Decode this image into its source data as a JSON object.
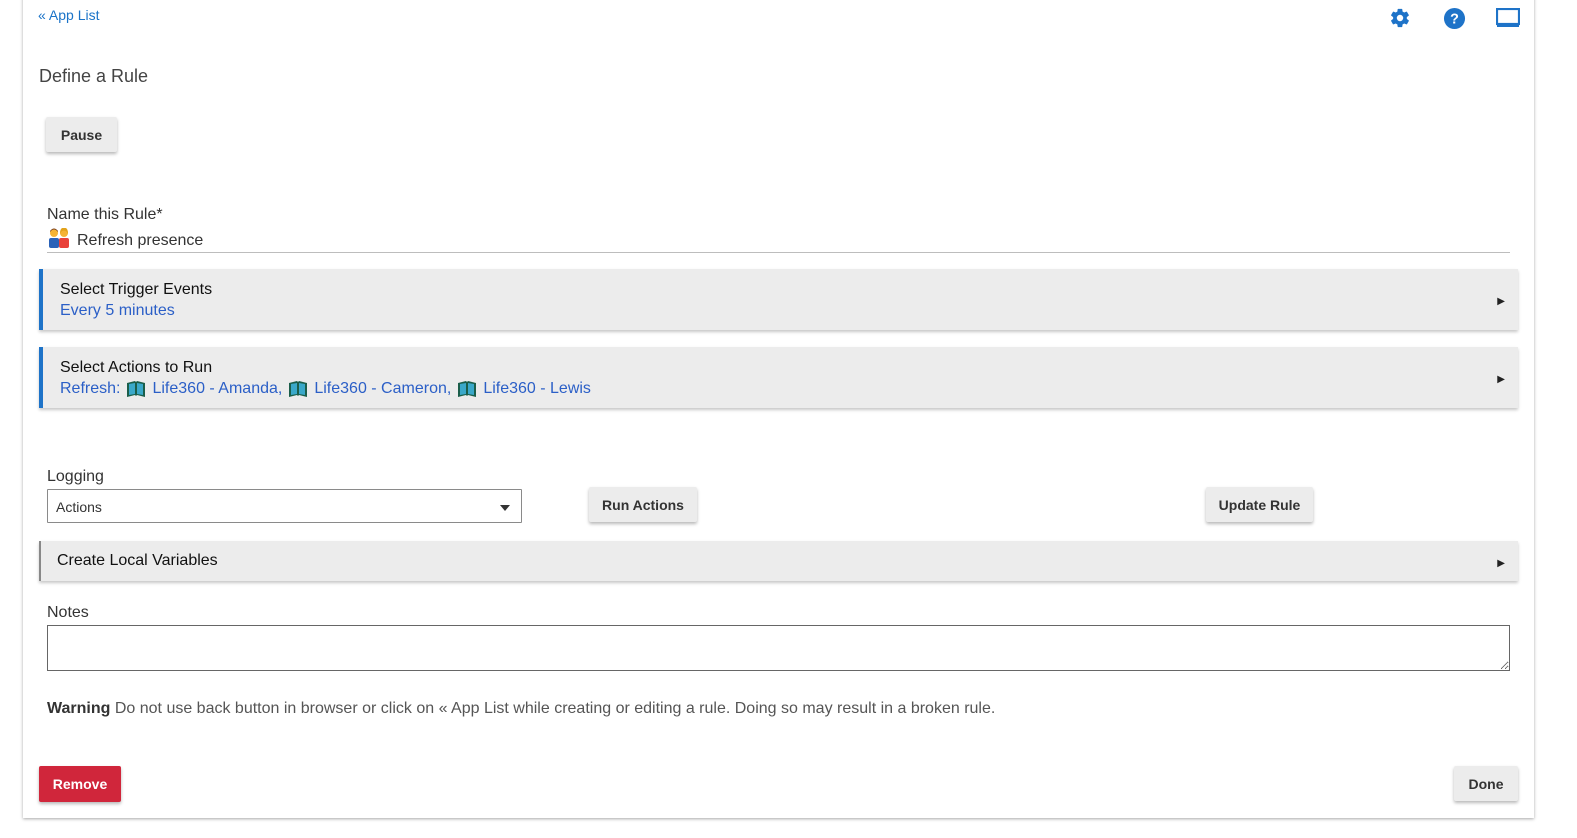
{
  "header": {
    "back_link": "« App List",
    "icons": [
      "gear-icon",
      "help-icon",
      "monitor-icon"
    ]
  },
  "page": {
    "title": "Define a Rule",
    "pause_label": "Pause"
  },
  "name_field": {
    "label": "Name this Rule*",
    "value": "Refresh presence",
    "icon": "people-emoji-icon"
  },
  "triggers": {
    "heading": "Select Trigger Events",
    "summary": "Every 5 minutes"
  },
  "actions": {
    "heading": "Select Actions to Run",
    "prefix": "Refresh:",
    "devices": [
      "Life360 - Amanda,",
      "Life360 - Cameron,",
      "Life360 - Lewis"
    ]
  },
  "logging": {
    "label": "Logging",
    "selected": "Actions"
  },
  "buttons": {
    "run_actions": "Run Actions",
    "update_rule": "Update Rule",
    "remove": "Remove",
    "done": "Done"
  },
  "local_vars": {
    "heading": "Create Local Variables"
  },
  "notes": {
    "label": "Notes",
    "value": ""
  },
  "warning": {
    "bold": "Warning",
    "text": " Do not use back button in browser or click on « App List while creating or editing a rule. Doing so may result in a broken rule."
  },
  "colors": {
    "accent": "#1e73c8",
    "link": "#2b5fc7",
    "remove": "#d0263b"
  }
}
